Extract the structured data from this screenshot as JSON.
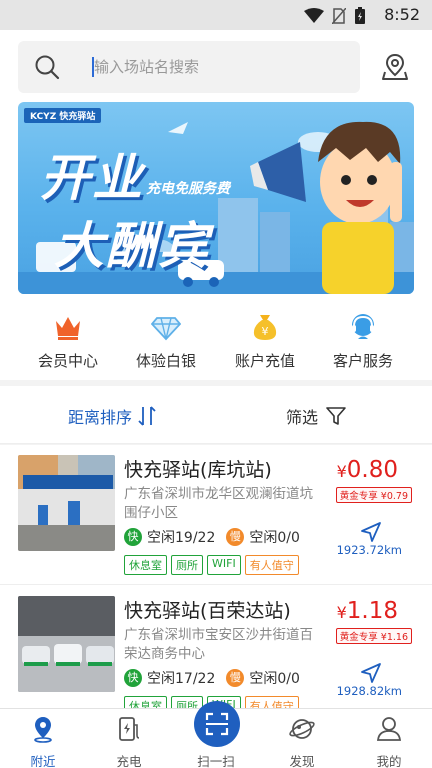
{
  "statusbar": {
    "time": "8:52"
  },
  "search": {
    "placeholder": "输入场站名搜索"
  },
  "banner": {
    "brand": "KCYZ 快充驿站",
    "headline_1": "开业",
    "headline_2": "大酬宾",
    "subline": "充电免服务费"
  },
  "menu": [
    {
      "label": "会员中心",
      "icon": "crown-icon"
    },
    {
      "label": "体验白银",
      "icon": "diamond-icon"
    },
    {
      "label": "账户充值",
      "icon": "money-bag-icon"
    },
    {
      "label": "客户服务",
      "icon": "headset-icon"
    }
  ],
  "sort": {
    "label": "距离排序",
    "filter_label": "筛选"
  },
  "stations": [
    {
      "name": "快充驿站(库坑站)",
      "address": "广东省深圳市龙华区观澜街道坑围仔小区",
      "fast_label": "快",
      "fast_status": "空闲19/22",
      "slow_label": "慢",
      "slow_status": "空闲0/0",
      "tags": [
        "休息室",
        "厕所",
        "WIFI",
        "有人值守"
      ],
      "currency": "¥",
      "price": "0.80",
      "member_price": "黄金专享 ¥0.79",
      "distance": "1923.72km"
    },
    {
      "name": "快充驿站(百荣达站)",
      "address": "广东省深圳市宝安区沙井街道百荣达商务中心",
      "fast_label": "快",
      "fast_status": "空闲17/22",
      "slow_label": "慢",
      "slow_status": "空闲0/0",
      "tags": [
        "休息室",
        "厕所",
        "WIFI",
        "有人值守"
      ],
      "currency": "¥",
      "price": "1.18",
      "member_price": "黄金专享 ¥1.16",
      "distance": "1928.82km"
    }
  ],
  "tabs": [
    {
      "label": "附近",
      "active": true
    },
    {
      "label": "充电"
    },
    {
      "label": "扫一扫"
    },
    {
      "label": "发现"
    },
    {
      "label": "我的"
    }
  ],
  "colors": {
    "primary": "#1f5fbf",
    "green": "#21a33a",
    "orange": "#f28a2b",
    "price_red": "#e0201d"
  }
}
